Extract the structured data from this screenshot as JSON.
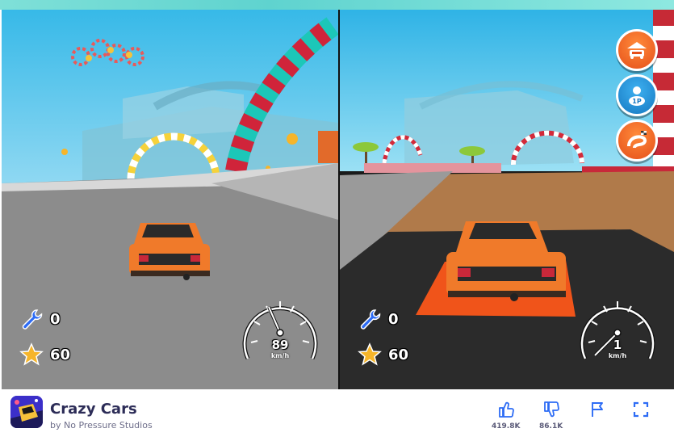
{
  "game_title": "Crazy Cars",
  "developer": "by No Pressure Studios",
  "player_left": {
    "wrenches": "0",
    "stars": "60",
    "speed": "89",
    "speed_unit": "km/h"
  },
  "player_right": {
    "wrenches": "0",
    "stars": "60",
    "speed": "1",
    "speed_unit": "km/h"
  },
  "side_buttons": [
    "garage-icon",
    "one-player-icon",
    "track-select-icon"
  ],
  "likes": "419.8K",
  "dislikes": "86.1K",
  "colors": {
    "accent": "#2d6cf5",
    "car": "#f07a2a",
    "button_orange": "#e5501a",
    "button_blue": "#1779c2"
  }
}
